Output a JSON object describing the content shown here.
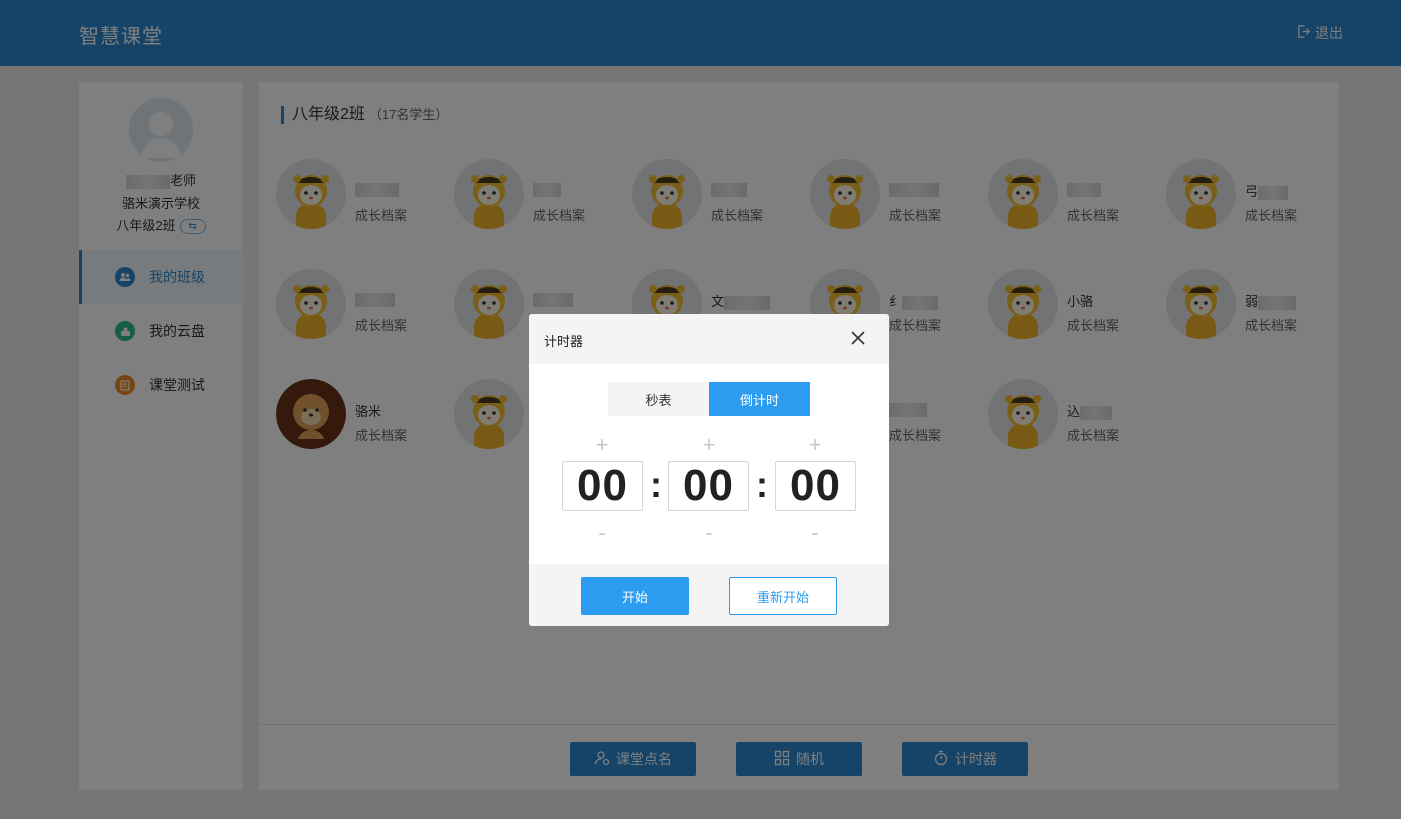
{
  "app": {
    "title": "智慧课堂",
    "logout_label": "退出"
  },
  "sidebar": {
    "teacher_suffix": "老师",
    "school": "骆米演示学校",
    "class_name": "八年级2班",
    "swap_icon": "⇆",
    "items": [
      {
        "label": "我的班级",
        "icon": "users-icon",
        "color": "#2b89d0",
        "active": true
      },
      {
        "label": "我的云盘",
        "icon": "cloud-disk-icon",
        "color": "#2fbd8e",
        "active": false
      },
      {
        "label": "课堂测试",
        "icon": "test-icon",
        "color": "#f08a24",
        "active": false
      }
    ]
  },
  "main": {
    "class_title": "八年级2班",
    "student_count": "（17名学生）",
    "profile_label": "成长档案",
    "students": [
      {
        "name": ""
      },
      {
        "name": ""
      },
      {
        "name": ""
      },
      {
        "name": ""
      },
      {
        "name": ""
      },
      {
        "name": "弓"
      },
      {
        "name": ""
      },
      {
        "name": ""
      },
      {
        "name": "文"
      },
      {
        "name": "纟"
      },
      {
        "name": "小骆"
      },
      {
        "name": "弱"
      },
      {
        "name": "骆米"
      },
      {
        "name": ""
      },
      {
        "name": ""
      },
      {
        "name": ""
      },
      {
        "name": "込"
      }
    ]
  },
  "bottom": {
    "rollcall_label": "课堂点名",
    "random_label": "随机",
    "timer_label": "计时器"
  },
  "modal": {
    "title": "计时器",
    "tab_stopwatch": "秒表",
    "tab_countdown": "倒计时",
    "hours": "00",
    "minutes": "00",
    "seconds": "00",
    "plus": "+",
    "minus": "-",
    "colon": ":",
    "start_label": "开始",
    "restart_label": "重新开始"
  },
  "colors": {
    "accent": "#2b89d0",
    "modal_accent": "#2b9cf0"
  }
}
